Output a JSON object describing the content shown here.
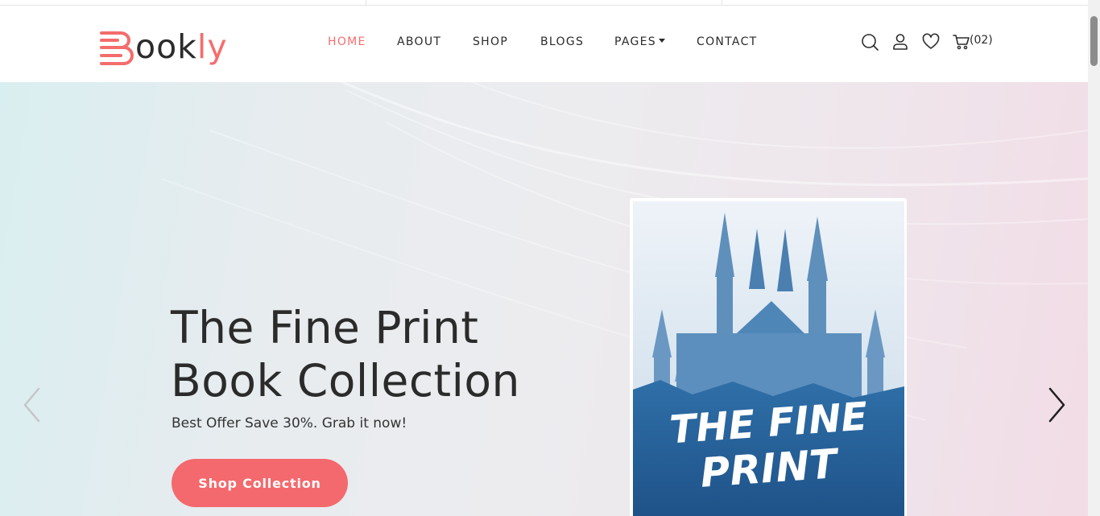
{
  "logo": {
    "text_main": "ook",
    "text_accent": "ly",
    "accent_color": "#f46d6d"
  },
  "nav": {
    "items": [
      {
        "label": "HOME",
        "active": true
      },
      {
        "label": "ABOUT",
        "active": false
      },
      {
        "label": "SHOP",
        "active": false
      },
      {
        "label": "BLOGS",
        "active": false
      },
      {
        "label": "PAGES",
        "active": false,
        "dropdown": true
      },
      {
        "label": "CONTACT",
        "active": false
      }
    ]
  },
  "header_icons": {
    "search": "search-icon",
    "account": "user-icon",
    "wishlist": "heart-icon",
    "cart": "cart-icon",
    "cart_count": "(02)"
  },
  "hero": {
    "title_line1": "The Fine Print",
    "title_line2": "Book Collection",
    "subtitle": "Best Offer Save 30%. Grab it now!",
    "cta_label": "Shop Collection",
    "cta_color": "#f4696d",
    "book_cover_title_line1": "THE FINE",
    "book_cover_title_line2": "PRINT",
    "prev_icon": "chevron-left-icon",
    "next_icon": "chevron-right-icon"
  }
}
